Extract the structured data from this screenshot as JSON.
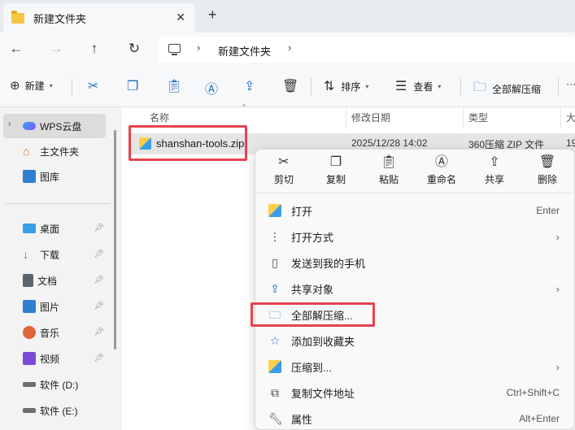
{
  "window": {
    "tab_title": "新建文件夹",
    "new_tab": "+",
    "close": "✕"
  },
  "address": {
    "path": [
      "新建文件夹"
    ]
  },
  "toolbar": {
    "new_label": "新建",
    "sort_label": "排序",
    "view_label": "查看",
    "extract_all_label": "全部解压缩",
    "more_label": "···"
  },
  "sidebar": {
    "items": [
      {
        "label": "WPS云盘",
        "icon": "cloud-icon",
        "selected": true
      },
      {
        "label": "主文件夹",
        "icon": "home-icon"
      },
      {
        "label": "图库",
        "icon": "gallery-icon"
      },
      {
        "label": "桌面",
        "icon": "desktop-icon",
        "pinned": true
      },
      {
        "label": "下载",
        "icon": "download-icon",
        "pinned": true
      },
      {
        "label": "文档",
        "icon": "document-icon",
        "pinned": true
      },
      {
        "label": "图片",
        "icon": "pictures-icon",
        "pinned": true
      },
      {
        "label": "音乐",
        "icon": "music-icon",
        "pinned": true
      },
      {
        "label": "视频",
        "icon": "video-icon",
        "pinned": true
      },
      {
        "label": "软件 (D:)",
        "icon": "drive-icon"
      },
      {
        "label": "软件 (E:)",
        "icon": "drive-icon"
      }
    ]
  },
  "columns": {
    "name": "名称",
    "modified": "修改日期",
    "type": "类型",
    "size": "大"
  },
  "file": {
    "name": "shanshan-tools.zip",
    "modified": "2025/12/28 14:02",
    "type": "360压缩 ZIP 文件",
    "size": "19"
  },
  "context_menu": {
    "quick_actions": [
      {
        "label": "剪切",
        "icon": "cut-icon"
      },
      {
        "label": "复制",
        "icon": "copy-icon"
      },
      {
        "label": "粘贴",
        "icon": "paste-icon"
      },
      {
        "label": "重命名",
        "icon": "rename-icon"
      },
      {
        "label": "共享",
        "icon": "share-icon"
      },
      {
        "label": "删除",
        "icon": "delete-icon"
      }
    ],
    "items": [
      {
        "label": "打开",
        "shortcut": "Enter",
        "icon": "zip-open-icon"
      },
      {
        "label": "打开方式",
        "submenu": true,
        "icon": "open-with-icon"
      },
      {
        "label": "发送到我的手机",
        "icon": "phone-icon"
      },
      {
        "label": "共享对象",
        "submenu": true,
        "icon": "share-to-icon"
      },
      {
        "label": "全部解压缩...",
        "icon": "extract-icon",
        "highlighted": true
      },
      {
        "label": "添加到收藏夹",
        "icon": "star-icon"
      },
      {
        "label": "压缩到...",
        "submenu": true,
        "icon": "compress-icon"
      },
      {
        "label": "复制文件地址",
        "shortcut": "Ctrl+Shift+C",
        "icon": "copy-path-icon"
      },
      {
        "label": "属性",
        "shortcut": "Alt+Enter",
        "icon": "properties-icon"
      }
    ]
  },
  "colors": {
    "highlight_box": "#e5434f",
    "accent": "#1f6fbf"
  }
}
